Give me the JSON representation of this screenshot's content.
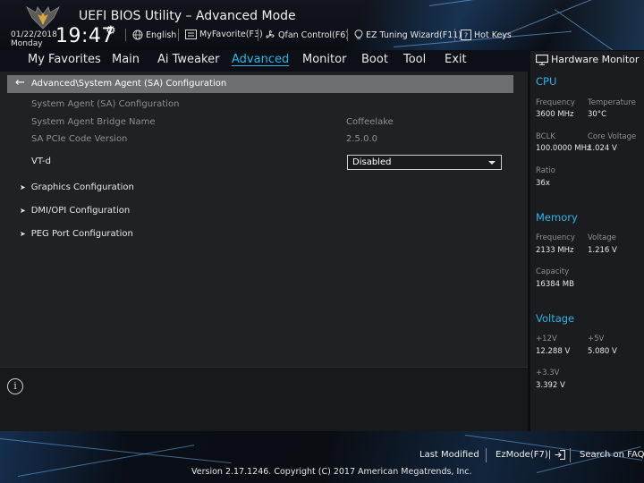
{
  "header": {
    "app_title": "UEFI BIOS Utility – Advanced Mode",
    "date": "01/22/2018",
    "day": "Monday",
    "time": "19:47",
    "language": "English",
    "my_favorite": "MyFavorite(F3)",
    "qfan": "Qfan Control(F6)",
    "ez_tuning": "EZ Tuning Wizard(F11)",
    "hot_keys": "Hot Keys"
  },
  "menu": {
    "items": [
      "My Favorites",
      "Main",
      "Ai Tweaker",
      "Advanced",
      "Monitor",
      "Boot",
      "Tool",
      "Exit"
    ],
    "active": "Advanced"
  },
  "main": {
    "breadcrumb": "Advanced\\System Agent (SA) Configuration",
    "section_title": "System Agent (SA) Configuration",
    "rows": [
      {
        "label": "System Agent Bridge Name",
        "value": "Coffeelake"
      },
      {
        "label": "SA PCIe Code Version",
        "value": "2.5.0.0"
      }
    ],
    "vtd": {
      "label": "VT-d",
      "value": "Disabled"
    },
    "submenus": [
      "Graphics Configuration",
      "DMI/OPI Configuration",
      "PEG Port Configuration"
    ]
  },
  "hardware_monitor": {
    "title": "Hardware Monitor",
    "cpu": {
      "heading": "CPU",
      "frequency_label": "Frequency",
      "frequency": "3600 MHz",
      "temperature_label": "Temperature",
      "temperature": "30°C",
      "bclk_label": "BCLK",
      "bclk": "100.0000 MHz",
      "core_voltage_label": "Core Voltage",
      "core_voltage": "1.024 V",
      "ratio_label": "Ratio",
      "ratio": "36x"
    },
    "memory": {
      "heading": "Memory",
      "frequency_label": "Frequency",
      "frequency": "2133 MHz",
      "voltage_label": "Voltage",
      "voltage": "1.216 V",
      "capacity_label": "Capacity",
      "capacity": "16384 MB"
    },
    "voltage": {
      "heading": "Voltage",
      "v12_label": "+12V",
      "v12": "12.288 V",
      "v5_label": "+5V",
      "v5": "5.080 V",
      "v33_label": "+3.3V",
      "v33": "3.392 V"
    }
  },
  "footer": {
    "last_modified": "Last Modified",
    "ez_mode": "EzMode(F7)|",
    "search_faq": "Search on FAQ",
    "copyright": "Version 2.17.1246. Copyright (C) 2017 American Megatrends, Inc."
  },
  "colors": {
    "accent": "#2fb4e6",
    "panel": "#202124",
    "breadcrumb_bar": "#6e6f71"
  }
}
